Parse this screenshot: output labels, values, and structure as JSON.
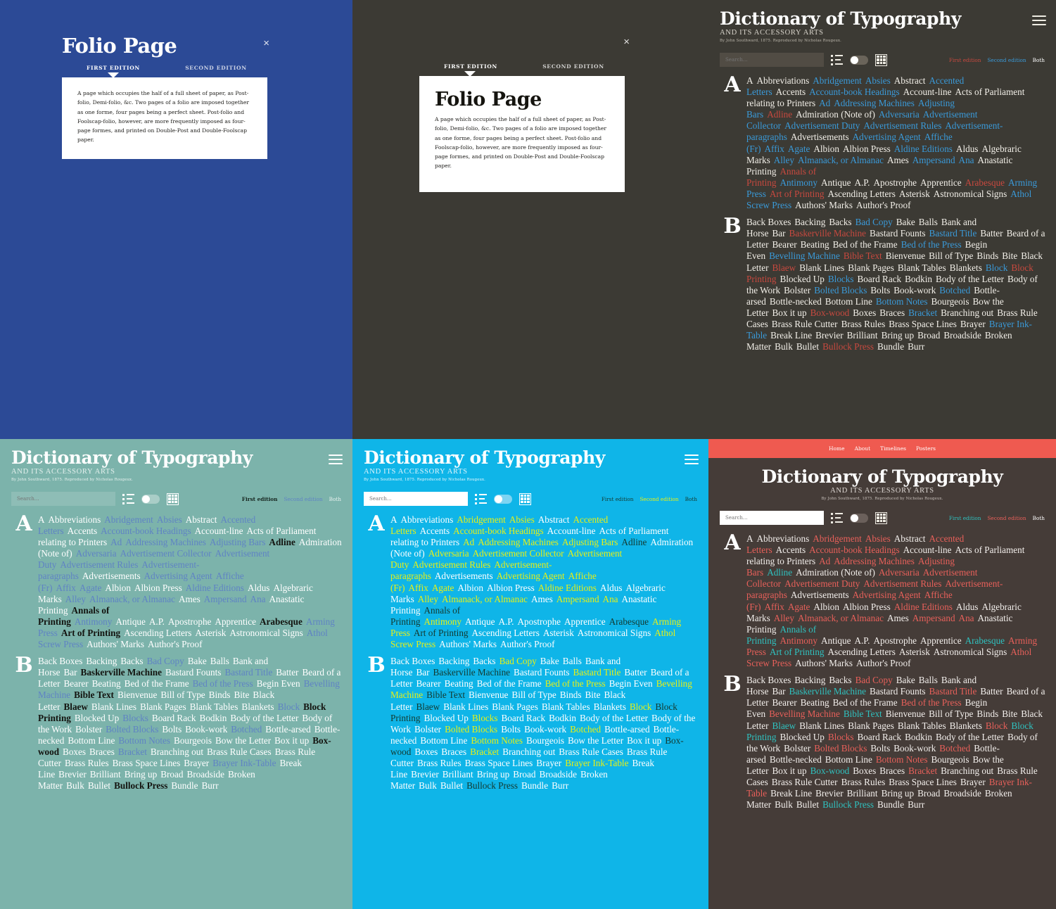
{
  "modal": {
    "title": "Folio Page",
    "close_label": "×",
    "tabs": [
      {
        "label": "FIRST EDITION",
        "active": true
      },
      {
        "label": "SECOND EDITION",
        "active": false
      }
    ],
    "definition": "A page which occupies the half of a full sheet of paper, as Post-folio, Demi-folio, &c. Two pages of a folio are imposed together as one forme, four pages being a perfect sheet. Post-folio and Foolscap-folio, however, are more frequently imposed as four-page formes, and printed on Double-Post and Double-Foolscap paper."
  },
  "header": {
    "title": "Dictionary of Typography",
    "subtitle": "AND ITS ACCESSORY ARTS",
    "byline": "By John Southward, 1875. Reproduced by Nicholas Rougeux.",
    "menu_icon": "hamburger-icon"
  },
  "topnav": {
    "items": [
      "Home",
      "About",
      "Timelines",
      "Posters"
    ]
  },
  "toolbar": {
    "search_placeholder": "Search...",
    "search_value": "",
    "list_icon": "list-view-icon",
    "toggle_icon": "view-toggle-switch",
    "grid_icon": "grid-view-icon",
    "editions": [
      "First edition",
      "Second edition",
      "Both"
    ]
  },
  "palette": {
    "blue_panel": "#2c4a96",
    "dark_panel": "#3c3a34",
    "teal_panel": "#7cb3ab",
    "cyan_panel": "#0fb5e8",
    "maroon_panel": "#453c38",
    "red_nav": "#ef5a50",
    "dark_first_edition": "#c8493f",
    "dark_second_edition": "#3a9ad9",
    "dark_both": "#ffffff",
    "teal_second_edition": "#5f83c4",
    "teal_first_edition": "#13130f",
    "cyan_second_edition": "#e8f015",
    "cyan_first_edition": "#14392f",
    "maroon_second_edition": "#e8605a",
    "maroon_first_edition": "#2fc2c0"
  },
  "letters": [
    {
      "letter": "A",
      "terms": [
        {
          "t": "A",
          "c": "both"
        },
        {
          "t": "Abbreviations",
          "c": "both"
        },
        {
          "t": "Abridgement",
          "c": "second"
        },
        {
          "t": "Absies",
          "c": "second"
        },
        {
          "t": "Abstract",
          "c": "both"
        },
        {
          "t": "Accented Letters",
          "c": "second"
        },
        {
          "t": "Accents",
          "c": "both"
        },
        {
          "t": "Account-book Headings",
          "c": "second"
        },
        {
          "t": "Account-line",
          "c": "both"
        },
        {
          "t": "Acts of Parliament relating to Printers",
          "c": "both"
        },
        {
          "t": "Ad",
          "c": "second"
        },
        {
          "t": "Addressing Machines",
          "c": "second"
        },
        {
          "t": "Adjusting Bars",
          "c": "second"
        },
        {
          "t": "Adline",
          "c": "first"
        },
        {
          "t": "Admiration (Note of)",
          "c": "both"
        },
        {
          "t": "Adversaria",
          "c": "second"
        },
        {
          "t": "Advertisement Collector",
          "c": "second"
        },
        {
          "t": "Advertisement Duty",
          "c": "second"
        },
        {
          "t": "Advertisement Rules",
          "c": "second"
        },
        {
          "t": "Advertisement-paragraphs",
          "c": "second"
        },
        {
          "t": "Advertisements",
          "c": "both"
        },
        {
          "t": "Advertising Agent",
          "c": "second"
        },
        {
          "t": "Affiche (Fr)",
          "c": "second"
        },
        {
          "t": "Affix",
          "c": "second"
        },
        {
          "t": "Agate",
          "c": "second"
        },
        {
          "t": "Albion",
          "c": "both"
        },
        {
          "t": "Albion Press",
          "c": "both"
        },
        {
          "t": "Aldine Editions",
          "c": "second"
        },
        {
          "t": "Aldus",
          "c": "both"
        },
        {
          "t": "Algebraric Marks",
          "c": "both"
        },
        {
          "t": "Alley",
          "c": "second"
        },
        {
          "t": "Almanack, or Almanac",
          "c": "second"
        },
        {
          "t": "Ames",
          "c": "both"
        },
        {
          "t": "Ampersand",
          "c": "second"
        },
        {
          "t": "Ana",
          "c": "second"
        },
        {
          "t": "Anastatic Printing",
          "c": "both"
        },
        {
          "t": "Annals of Printing",
          "c": "first"
        },
        {
          "t": "Antimony",
          "c": "second"
        },
        {
          "t": "Antique",
          "c": "both"
        },
        {
          "t": "A.P.",
          "c": "both"
        },
        {
          "t": "Apostrophe",
          "c": "both"
        },
        {
          "t": "Apprentice",
          "c": "both"
        },
        {
          "t": "Arabesque",
          "c": "first"
        },
        {
          "t": "Arming Press",
          "c": "second"
        },
        {
          "t": "Art of Printing",
          "c": "first"
        },
        {
          "t": "Ascending Letters",
          "c": "both"
        },
        {
          "t": "Asterisk",
          "c": "both"
        },
        {
          "t": "Astronomical Signs",
          "c": "both"
        },
        {
          "t": "Athol Screw Press",
          "c": "second"
        },
        {
          "t": "Authors' Marks",
          "c": "both"
        },
        {
          "t": "Author's Proof",
          "c": "both"
        }
      ]
    },
    {
      "letter": "B",
      "terms": [
        {
          "t": "Back Boxes",
          "c": "both"
        },
        {
          "t": "Backing",
          "c": "both"
        },
        {
          "t": "Backs",
          "c": "both"
        },
        {
          "t": "Bad Copy",
          "c": "second"
        },
        {
          "t": "Bake",
          "c": "both"
        },
        {
          "t": "Balls",
          "c": "both"
        },
        {
          "t": "Bank and Horse",
          "c": "both"
        },
        {
          "t": "Bar",
          "c": "both"
        },
        {
          "t": "Baskerville Machine",
          "c": "first"
        },
        {
          "t": "Bastard Founts",
          "c": "both"
        },
        {
          "t": "Bastard Title",
          "c": "second"
        },
        {
          "t": "Batter",
          "c": "both"
        },
        {
          "t": "Beard of a Letter",
          "c": "both"
        },
        {
          "t": "Bearer",
          "c": "both"
        },
        {
          "t": "Beating",
          "c": "both"
        },
        {
          "t": "Bed of the Frame",
          "c": "both"
        },
        {
          "t": "Bed of the Press",
          "c": "second"
        },
        {
          "t": "Begin Even",
          "c": "both"
        },
        {
          "t": "Bevelling Machine",
          "c": "second"
        },
        {
          "t": "Bible Text",
          "c": "first"
        },
        {
          "t": "Bienvenue",
          "c": "both"
        },
        {
          "t": "Bill of Type",
          "c": "both"
        },
        {
          "t": "Binds",
          "c": "both"
        },
        {
          "t": "Bite",
          "c": "both"
        },
        {
          "t": "Black Letter",
          "c": "both"
        },
        {
          "t": "Blaew",
          "c": "first"
        },
        {
          "t": "Blank Lines",
          "c": "both"
        },
        {
          "t": "Blank Pages",
          "c": "both"
        },
        {
          "t": "Blank Tables",
          "c": "both"
        },
        {
          "t": "Blankets",
          "c": "both"
        },
        {
          "t": "Block",
          "c": "second"
        },
        {
          "t": "Block Printing",
          "c": "first"
        },
        {
          "t": "Blocked Up",
          "c": "both"
        },
        {
          "t": "Blocks",
          "c": "second"
        },
        {
          "t": "Board Rack",
          "c": "both"
        },
        {
          "t": "Bodkin",
          "c": "both"
        },
        {
          "t": "Body of the Letter",
          "c": "both"
        },
        {
          "t": "Body of the Work",
          "c": "both"
        },
        {
          "t": "Bolster",
          "c": "both"
        },
        {
          "t": "Bolted Blocks",
          "c": "second"
        },
        {
          "t": "Bolts",
          "c": "both"
        },
        {
          "t": "Book-work",
          "c": "both"
        },
        {
          "t": "Botched",
          "c": "second"
        },
        {
          "t": "Bottle-arsed",
          "c": "both"
        },
        {
          "t": "Bottle-necked",
          "c": "both"
        },
        {
          "t": "Bottom Line",
          "c": "both"
        },
        {
          "t": "Bottom Notes",
          "c": "second"
        },
        {
          "t": "Bourgeois",
          "c": "both"
        },
        {
          "t": "Bow the Letter",
          "c": "both"
        },
        {
          "t": "Box it up",
          "c": "both"
        },
        {
          "t": "Box-wood",
          "c": "first"
        },
        {
          "t": "Boxes",
          "c": "both"
        },
        {
          "t": "Braces",
          "c": "both"
        },
        {
          "t": "Bracket",
          "c": "second"
        },
        {
          "t": "Branching out",
          "c": "both"
        },
        {
          "t": "Brass Rule Cases",
          "c": "both"
        },
        {
          "t": "Brass Rule Cutter",
          "c": "both"
        },
        {
          "t": "Brass Rules",
          "c": "both"
        },
        {
          "t": "Brass Space Lines",
          "c": "both"
        },
        {
          "t": "Brayer",
          "c": "both"
        },
        {
          "t": "Brayer Ink-Table",
          "c": "second"
        },
        {
          "t": "Break Line",
          "c": "both"
        },
        {
          "t": "Brevier",
          "c": "both"
        },
        {
          "t": "Brilliant",
          "c": "both"
        },
        {
          "t": "Bring up",
          "c": "both"
        },
        {
          "t": "Broad",
          "c": "both"
        },
        {
          "t": "Broadside",
          "c": "both"
        },
        {
          "t": "Broken Matter",
          "c": "both"
        },
        {
          "t": "Bulk",
          "c": "both"
        },
        {
          "t": "Bullet",
          "c": "both"
        },
        {
          "t": "Bullock Press",
          "c": "first"
        },
        {
          "t": "Bundle",
          "c": "both"
        },
        {
          "t": "Burr",
          "c": "both"
        }
      ]
    }
  ]
}
